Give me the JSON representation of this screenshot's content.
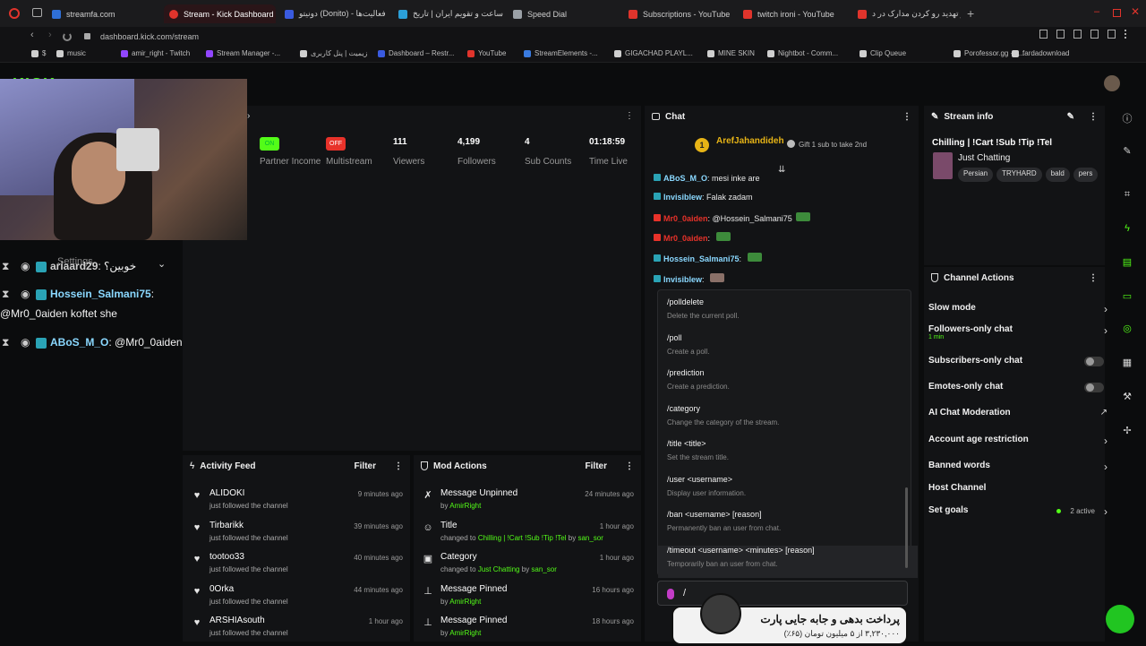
{
  "browser": {
    "tabs": [
      {
        "label": "streamfa.com",
        "color": "#2f6fd6"
      },
      {
        "label": "Stream - Kick Dashboard",
        "color": "#e0342c"
      },
      {
        "label": "دونیتو (Donito) - فعالیت‌ها",
        "color": "#3a5be0"
      },
      {
        "label": "ساعت و تقویم ایران | تاریخ",
        "color": "#2b9fd8"
      },
      {
        "label": "Speed Dial",
        "color": "#9aa0a6"
      },
      {
        "label": "Subscriptions - YouTube",
        "color": "#e0342c"
      },
      {
        "label": "twitch ironi - YouTube",
        "color": "#e0342c"
      },
      {
        "label": "از تهدید رو کردن مدارک در د...",
        "color": "#e0342c"
      }
    ],
    "url": "dashboard.kick.com/stream",
    "bookmarks": [
      {
        "label": "$",
        "color": "#cfcfcf"
      },
      {
        "label": "music",
        "color": "#cfcfcf"
      },
      {
        "label": "amir_right - Twitch",
        "color": "#9146ff"
      },
      {
        "label": "Stream Manager -...",
        "color": "#9146ff"
      },
      {
        "label": "زیمیت | پنل کاربری",
        "color": "#cfcfcf"
      },
      {
        "label": "Dashboard – Restr...",
        "color": "#3a5be0"
      },
      {
        "label": "YouTube",
        "color": "#e0342c"
      },
      {
        "label": "StreamElements -...",
        "color": "#3a7be0"
      },
      {
        "label": "GIGACHAD PLAYL...",
        "color": "#cfcfcf"
      },
      {
        "label": "MINE SKIN",
        "color": "#cfcfcf"
      },
      {
        "label": "Nightbot - Comm...",
        "color": "#cfcfcf"
      },
      {
        "label": "Clip Queue",
        "color": "#cfcfcf"
      },
      {
        "label": "Porofessor.gg - L...",
        "color": "#cfcfcf"
      },
      {
        "label": "fardadownload",
        "color": "#cfcfcf"
      }
    ]
  },
  "stats": [
    {
      "value": "ON",
      "label": "Partner Income",
      "badge": true,
      "badge_color": "#53fc18"
    },
    {
      "value": "OFF",
      "label": "Multistream",
      "badge": true,
      "badge_color": "#e8322a"
    },
    {
      "value": "111",
      "label": "Viewers"
    },
    {
      "value": "4,199",
      "label": "Followers"
    },
    {
      "value": "4",
      "label": "Sub Counts"
    },
    {
      "value": "01:18:59",
      "label": "Time Live"
    }
  ],
  "activity_feed": {
    "title": "Activity Feed",
    "filter": "Filter",
    "items": [
      {
        "name": "ALIDOKI",
        "desc": "just followed the channel",
        "time": "9 minutes ago"
      },
      {
        "name": "Tirbarikk",
        "desc": "just followed the channel",
        "time": "39 minutes ago"
      },
      {
        "name": "tootoo33",
        "desc": "just followed the channel",
        "time": "40 minutes ago"
      },
      {
        "name": "0Orka",
        "desc": "just followed the channel",
        "time": "44 minutes ago"
      },
      {
        "name": "ARSHIAsouth",
        "desc": "just followed the channel",
        "time": "1 hour ago"
      }
    ]
  },
  "mod_actions": {
    "title": "Mod Actions",
    "filter": "Filter",
    "items": [
      {
        "title": "Message Unpinned",
        "desc_pre": "by ",
        "user": "AmirRight",
        "time": "24 minutes ago",
        "icon": "unpin-icon"
      },
      {
        "title": "Title",
        "desc_pre": "changed to ",
        "user": "Chilling | !Cart !Sub !Tip !Tel",
        "desc_post": " by ",
        "user2": "san_sor",
        "time": "1 hour ago",
        "icon": "title-icon"
      },
      {
        "title": "Category",
        "desc_pre": "changed to ",
        "user": "Just Chatting",
        "desc_post": " by ",
        "user2": "san_sor",
        "time": "1 hour ago",
        "icon": "category-icon"
      },
      {
        "title": "Message Pinned",
        "desc_pre": "by ",
        "user": "AmirRight",
        "time": "16 hours ago",
        "icon": "pin-icon"
      },
      {
        "title": "Message Pinned",
        "desc_pre": "by ",
        "user": "AmirRight",
        "time": "18 hours ago",
        "icon": "pin-icon"
      }
    ]
  },
  "chat": {
    "title": "Chat",
    "pinned_user": "ArefJahandideh",
    "pinned_rank": "1",
    "pinned_gift": "Gift 1 sub to take 2nd",
    "messages": [
      {
        "user": "ABoS_M_O",
        "text": "mesi inke are",
        "color": "#53fc18"
      },
      {
        "user": "Invisiblew",
        "text": "Falak zadam",
        "color": "#53fc18"
      },
      {
        "user": "Mr0_0aiden",
        "text": "@Hossein_Salmani75",
        "color": "#e8322a"
      },
      {
        "user": "Mr0_0aiden",
        "text": "",
        "color": "#e8322a"
      },
      {
        "user": "Hossein_Salmani75",
        "text": "",
        "color": "#53fc18"
      },
      {
        "user": "Invisiblew",
        "text": "",
        "color": "#53fc18"
      }
    ],
    "commands": [
      {
        "cmd": "/polldelete",
        "help": "Delete the current poll."
      },
      {
        "cmd": "/poll",
        "help": "Create a poll."
      },
      {
        "cmd": "/prediction",
        "help": "Create a prediction."
      },
      {
        "cmd": "/category",
        "help": "Change the category of the stream."
      },
      {
        "cmd": "/title <title>",
        "help": "Set the stream title."
      },
      {
        "cmd": "/user <username>",
        "help": "Display user information."
      },
      {
        "cmd": "/ban <username> [reason]",
        "help": "Permanently ban an user from chat."
      },
      {
        "cmd": "/timeout <username> <minutes> [reason]",
        "help": "Temporarily ban an user from chat."
      }
    ],
    "input_value": "/"
  },
  "stream_info": {
    "title": "Stream info",
    "stream_title": "Chilling | !Cart !Sub !Tip !Tel",
    "category": "Just Chatting",
    "tags": [
      "Persian",
      "TRYHARD",
      "bald",
      "pers"
    ]
  },
  "channel_actions": {
    "title": "Channel Actions",
    "items": [
      {
        "label": "Slow mode",
        "type": "arrow"
      },
      {
        "label": "Followers-only chat",
        "sub": "1 min",
        "type": "arrow"
      },
      {
        "label": "Subscribers-only chat",
        "type": "toggle"
      },
      {
        "label": "Emotes-only chat",
        "type": "toggle"
      },
      {
        "label": "AI Chat Moderation",
        "type": "external"
      },
      {
        "label": "Account age restriction",
        "type": "arrow"
      },
      {
        "label": "Banned words",
        "type": "arrow"
      },
      {
        "label": "Host Channel",
        "type": "none"
      },
      {
        "label": "Set goals",
        "extra": "2 active",
        "type": "arrow"
      }
    ]
  },
  "overlay_chat": [
    {
      "user": "ariaard29",
      "text": "خوبین؟",
      "color": "#cfcfcf"
    },
    {
      "user": "Hossein_Salmani75",
      "text": "",
      "color": "#53fc18"
    },
    {
      "user": "",
      "text": "@Mr0_0aiden koftet she",
      "color": "#ffffff"
    },
    {
      "user": "ABoS_M_O",
      "text": "@Mr0_0aiden",
      "color": "#53fc18"
    }
  ],
  "overlay_settings": "Settings",
  "ad_banner": {
    "line1": "پرداخت بدهی و جابه جایی پارت",
    "line2": "۳,۲۳۰,۰۰۰ از ۵ میلیون تومان (۶۵٪)"
  },
  "accent": "#53fc18"
}
